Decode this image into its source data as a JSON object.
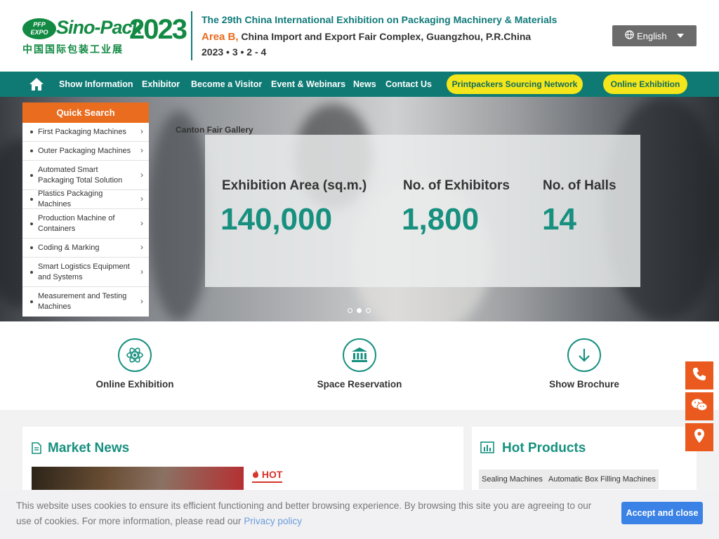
{
  "header": {
    "logo": {
      "badge_line1": "PFP",
      "badge_line2": "EXPO",
      "brand": "Sino-Pack",
      "year": "2023",
      "chinese": "中国国际包装工业展"
    },
    "event_title": "The 29th China International Exhibition on Packaging Machinery & Materials",
    "venue_area": "Area B,",
    "venue_rest": " China Import and Export Fair Complex, Guangzhou, P.R.China",
    "date": "2023 • 3 • 2 - 4",
    "language": "English"
  },
  "nav": {
    "items": [
      "Show Information",
      "Exhibitor",
      "Become a Visitor",
      "Event & Webinars",
      "News",
      "Contact Us"
    ],
    "pills": [
      "Printpackers Sourcing Network",
      "Online Exhibition"
    ]
  },
  "quick_search": {
    "title": "Quick Search",
    "items": [
      "First Packaging Machines",
      "Outer Packaging Machines",
      "Automated Smart Packaging Total Solution",
      "Plastics Packaging Machines",
      "Production Machine of Containers",
      "Coding & Marking",
      "Smart Logistics Equipment and Systems",
      "Measurement and Testing Machines"
    ]
  },
  "hero": {
    "background_text": "Canton Fair Gallery",
    "stats": [
      {
        "label": "Exhibition Area (sq.m.)",
        "value": "140,000"
      },
      {
        "label": "No. of Exhibitors",
        "value": "1,800"
      },
      {
        "label": "No. of Halls",
        "value": "14"
      }
    ],
    "slide_count": 3,
    "active_slide": 2
  },
  "features": [
    {
      "label": "Online Exhibition",
      "icon": "atom-icon"
    },
    {
      "label": "Space Reservation",
      "icon": "bank-icon"
    },
    {
      "label": "Show Brochure",
      "icon": "download-arrow-icon"
    }
  ],
  "market_news": {
    "title": "Market News",
    "hot_label": "HOT"
  },
  "hot_products": {
    "title": "Hot Products",
    "tags": [
      "Sealing Machines",
      "Automatic Box Filling Machines"
    ]
  },
  "side_buttons": [
    "phone-icon",
    "wechat-icon",
    "location-pin-icon"
  ],
  "cookie": {
    "text": "This website uses cookies to ensure its efficient functioning and better browsing experience. By browsing this site you are agreeing to our use of cookies. For more information, please read our",
    "link": "Privacy policy",
    "button": "Accept and close"
  },
  "colors": {
    "teal": "#0f7a74",
    "teal_text": "#17907f",
    "orange": "#ea6d1f",
    "yellow": "#f4e61a",
    "brand_green": "#138a43",
    "cookie_button": "#3b82e6"
  }
}
